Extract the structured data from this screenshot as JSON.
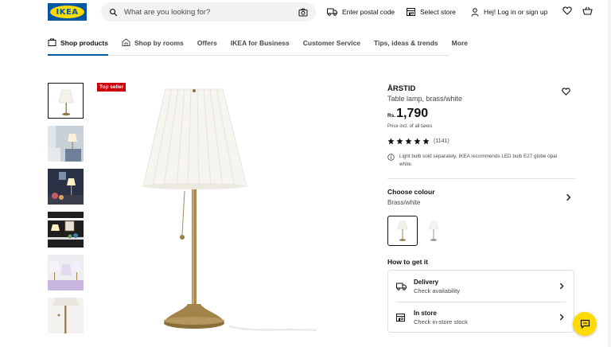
{
  "header": {
    "logo_text": "IKEA",
    "search_placeholder": "What are you looking for?",
    "postal_label": "Enter postal code",
    "store_label": "Select store",
    "login_label": "Hej! Log in or sign up"
  },
  "nav": {
    "items": [
      "Shop products",
      "Shop by rooms",
      "Offers",
      "IKEA for Business",
      "Customer Service",
      "Tips, ideas & trends",
      "More"
    ],
    "active": "Shop products"
  },
  "product": {
    "badge": "Top seller",
    "name": "ÅRSTID",
    "description": "Table lamp, brass/white",
    "currency": "Rs.",
    "price": "1,790",
    "price_note": "Price incl. of all taxes",
    "rating_stars": 5,
    "review_count": "(1141)",
    "info_note": "Light bulb sold separately. IKEA recommends LED bulb E27 globe opal white."
  },
  "colour": {
    "heading": "Choose colour",
    "selected": "Brass/white"
  },
  "get_it": {
    "heading": "How to get it",
    "delivery_title": "Delivery",
    "delivery_sub": "Check availability",
    "store_title": "In store",
    "store_sub": "Check in-store stock"
  },
  "colors": {
    "brand_blue": "#0058a3",
    "brand_yellow": "#ffdb00",
    "badge_red": "#cc0008"
  }
}
